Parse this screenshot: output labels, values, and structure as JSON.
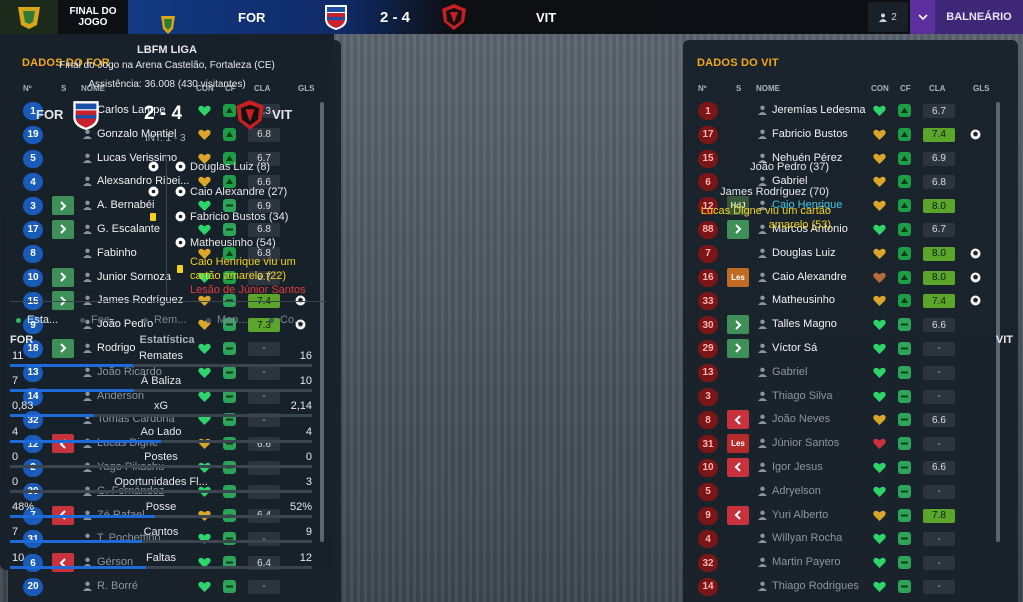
{
  "topbar": {
    "match_status": "FINAL DO JOGO",
    "home_abbr": "FOR",
    "score": "2 - 4",
    "away_abbr": "VIT",
    "viewers": "2",
    "dressing_room_label": "BALNEÁRIO"
  },
  "colors": {
    "home_blue": "#1a5ab8",
    "away_red": "#7a1616",
    "accent_orange": "#f4a81d",
    "rating_green": "#5aa52a",
    "bar_blue": "#1d6ad8",
    "card_yellow": "#f2d21f"
  },
  "home": {
    "title": "DADOS DO FOR",
    "columns": {
      "num": "Nº",
      "s": "S",
      "name": "NOME",
      "con": "CON",
      "cf": "CF",
      "cla": "CLA",
      "gls": "GLS"
    },
    "players": [
      {
        "num": "1",
        "sub": "",
        "name": "Carlos Lampe",
        "heart": "green",
        "cf": "up",
        "rating": "6.3",
        "good": false,
        "goal": false,
        "bench": false
      },
      {
        "num": "19",
        "sub": "",
        "name": "Gonzalo Montiel",
        "heart": "gold",
        "cf": "up",
        "rating": "6.8",
        "good": false,
        "goal": false,
        "bench": false
      },
      {
        "num": "5",
        "sub": "",
        "name": "Lucas Verissimo",
        "heart": "gold",
        "cf": "up",
        "rating": "6.7",
        "good": false,
        "goal": false,
        "bench": false
      },
      {
        "num": "4",
        "sub": "",
        "name": "Alexsandro Ribei...",
        "heart": "gold",
        "cf": "up",
        "rating": "6.6",
        "good": false,
        "goal": false,
        "bench": false
      },
      {
        "num": "3",
        "sub": "in",
        "name": "A. Bernabéi",
        "heart": "green",
        "cf": "flat",
        "rating": "6.9",
        "good": false,
        "goal": false,
        "bench": false
      },
      {
        "num": "17",
        "sub": "in",
        "name": "G. Escalante",
        "heart": "green",
        "cf": "flat",
        "rating": "6.8",
        "good": false,
        "goal": false,
        "bench": false
      },
      {
        "num": "8",
        "sub": "",
        "name": "Fabinho",
        "heart": "gold",
        "cf": "up",
        "rating": "6.8",
        "good": false,
        "goal": false,
        "bench": false
      },
      {
        "num": "10",
        "sub": "in",
        "name": "Junior Sornoza",
        "heart": "green",
        "cf": "up",
        "rating": "6.7",
        "good": false,
        "goal": false,
        "bench": false
      },
      {
        "num": "15",
        "sub": "in",
        "name": "James Rodríguez",
        "heart": "gold",
        "cf": "flat",
        "rating": "7.4",
        "good": true,
        "goal": true,
        "bench": false
      },
      {
        "num": "9",
        "sub": "",
        "name": "João Pedro",
        "heart": "gold",
        "cf": "flat",
        "rating": "7.3",
        "good": true,
        "goal": true,
        "bench": false
      },
      {
        "num": "18",
        "sub": "in",
        "name": "Rodrigo",
        "heart": "green",
        "cf": "flat",
        "rating": "-",
        "good": false,
        "goal": false,
        "bench": false
      },
      {
        "num": "13",
        "sub": "",
        "name": "João Ricardo",
        "heart": "green",
        "cf": "flat",
        "rating": "-",
        "good": false,
        "goal": false,
        "bench": true
      },
      {
        "num": "14",
        "sub": "",
        "name": "Anderson",
        "heart": "green",
        "cf": "flat",
        "rating": "-",
        "good": false,
        "goal": false,
        "bench": true
      },
      {
        "num": "32",
        "sub": "",
        "name": "Tomás Cardona",
        "heart": "green",
        "cf": "flat",
        "rating": "-",
        "good": false,
        "goal": false,
        "bench": true
      },
      {
        "num": "12",
        "sub": "out",
        "name": "Lucas Digne",
        "heart": "gold",
        "cf": "flat",
        "rating": "6.6",
        "good": false,
        "goal": false,
        "bench": true
      },
      {
        "num": "2",
        "sub": "",
        "name": "Yago Pikachu",
        "heart": "green",
        "cf": "flat",
        "rating": "-",
        "good": false,
        "goal": false,
        "bench": true
      },
      {
        "num": "30",
        "sub": "",
        "name": "G. Fernández",
        "heart": "green",
        "cf": "flat",
        "rating": "-",
        "good": false,
        "goal": false,
        "bench": true,
        "underline": true
      },
      {
        "num": "7",
        "sub": "out",
        "name": "Zé Rafael",
        "heart": "gold",
        "cf": "flat",
        "rating": "6.4",
        "good": false,
        "goal": false,
        "bench": true
      },
      {
        "num": "31",
        "sub": "",
        "name": "T. Pochettino",
        "heart": "green",
        "cf": "flat",
        "rating": "-",
        "good": false,
        "goal": false,
        "bench": true
      },
      {
        "num": "6",
        "sub": "out",
        "name": "Gérson",
        "heart": "green",
        "cf": "flat",
        "rating": "6.4",
        "good": false,
        "goal": false,
        "bench": true
      },
      {
        "num": "20",
        "sub": "",
        "name": "R. Borré",
        "heart": "green",
        "cf": "flat",
        "rating": "-",
        "good": false,
        "goal": false,
        "bench": true
      }
    ]
  },
  "away": {
    "title": "DADOS DO VIT",
    "columns": {
      "num": "Nº",
      "s": "S",
      "name": "NOME",
      "con": "CON",
      "cf": "CF",
      "cla": "CLA",
      "gls": "GLS"
    },
    "players": [
      {
        "num": "1",
        "sub": "",
        "name": "Jeremías Ledesma",
        "heart": "green",
        "cf": "up",
        "rating": "6.7",
        "good": false,
        "goal": false,
        "bench": false
      },
      {
        "num": "17",
        "sub": "",
        "name": "Fabricio Bustos",
        "heart": "gold",
        "cf": "up",
        "rating": "7.4",
        "good": true,
        "goal": true,
        "bench": false
      },
      {
        "num": "15",
        "sub": "",
        "name": "Nehuén Pérez",
        "heart": "gold",
        "cf": "up",
        "rating": "6.9",
        "good": false,
        "goal": false,
        "bench": false
      },
      {
        "num": "6",
        "sub": "",
        "name": "Gabriel",
        "heart": "gold",
        "cf": "up",
        "rating": "6.8",
        "good": false,
        "goal": false,
        "bench": false
      },
      {
        "num": "12",
        "sub": "tag",
        "tag": "HdJ",
        "name": "Caio Henrique",
        "heart": "gold",
        "cf": "up",
        "rating": "8.0",
        "good": true,
        "goal": false,
        "bench": false,
        "link": true
      },
      {
        "num": "88",
        "sub": "in",
        "name": "Marcos Antonio",
        "heart": "green",
        "cf": "up",
        "rating": "6.7",
        "good": false,
        "goal": false,
        "bench": false
      },
      {
        "num": "7",
        "sub": "",
        "name": "Douglas Luiz",
        "heart": "gold",
        "cf": "up",
        "rating": "8.0",
        "good": true,
        "goal": true,
        "bench": false
      },
      {
        "num": "16",
        "sub": "tag",
        "tag": "Les",
        "name": "Caio Alexandre",
        "heart": "brown",
        "cf": "up",
        "rating": "8.0",
        "good": true,
        "goal": true,
        "bench": false
      },
      {
        "num": "33",
        "sub": "",
        "name": "Matheusinho",
        "heart": "gold",
        "cf": "up",
        "rating": "7.4",
        "good": true,
        "goal": true,
        "bench": false
      },
      {
        "num": "30",
        "sub": "in",
        "name": "Talles Magno",
        "heart": "green",
        "cf": "flat",
        "rating": "6.6",
        "good": false,
        "goal": false,
        "bench": false
      },
      {
        "num": "29",
        "sub": "in",
        "name": "Víctor Sá",
        "heart": "green",
        "cf": "flat",
        "rating": "-",
        "good": false,
        "goal": false,
        "bench": false
      },
      {
        "num": "13",
        "sub": "",
        "name": "Gabriel",
        "heart": "green",
        "cf": "flat",
        "rating": "-",
        "good": false,
        "goal": false,
        "bench": true
      },
      {
        "num": "3",
        "sub": "",
        "name": "Thiago Silva",
        "heart": "green",
        "cf": "flat",
        "rating": "-",
        "good": false,
        "goal": false,
        "bench": true
      },
      {
        "num": "8",
        "sub": "out",
        "name": "João Neves",
        "heart": "gold",
        "cf": "flat",
        "rating": "6.6",
        "good": false,
        "goal": false,
        "bench": true
      },
      {
        "num": "31",
        "sub": "tagred",
        "tag": "Les",
        "name": "Júnior Santos",
        "heart": "red",
        "cf": "flat",
        "rating": "-",
        "good": false,
        "goal": false,
        "bench": true
      },
      {
        "num": "10",
        "sub": "out",
        "name": "Igor Jesus",
        "heart": "green",
        "cf": "flat",
        "rating": "6.6",
        "good": false,
        "goal": false,
        "bench": true
      },
      {
        "num": "5",
        "sub": "",
        "name": "Adryelson",
        "heart": "green",
        "cf": "flat",
        "rating": "-",
        "good": false,
        "goal": false,
        "bench": true
      },
      {
        "num": "9",
        "sub": "out",
        "name": "Yuri Alberto",
        "heart": "gold",
        "cf": "flat",
        "rating": "7.8",
        "good": true,
        "goal": false,
        "bench": true
      },
      {
        "num": "4",
        "sub": "",
        "name": "Willyan Rocha",
        "heart": "green",
        "cf": "flat",
        "rating": "-",
        "good": false,
        "goal": false,
        "bench": true
      },
      {
        "num": "32",
        "sub": "",
        "name": "Martin Payero",
        "heart": "green",
        "cf": "flat",
        "rating": "-",
        "good": false,
        "goal": false,
        "bench": true
      },
      {
        "num": "14",
        "sub": "",
        "name": "Thiago Rodrigues",
        "heart": "green",
        "cf": "flat",
        "rating": "-",
        "good": false,
        "goal": false,
        "bench": true
      }
    ]
  },
  "center": {
    "league": "LBFM LIGA",
    "venue": "Final do Jogo na Arena Castelão, Fortaleza (CE)",
    "attendance": "Assistência: 36.008 (430 visitantes)",
    "home_abbr": "FOR",
    "score": "2 - 4",
    "away_abbr": "VIT",
    "halftime": "INT: 1 - 3",
    "home_events": [
      "João Pedro (37)",
      "James Rodríguez (70)",
      "Lucas Digne viu um cartão",
      "amarelo (53)"
    ],
    "away_events": [
      "Douglas Luiz (8)",
      "Caio Alexandre (27)",
      "Fabricio Bustos (34)",
      "Matheusinho (54)",
      "Caio Henrique viu um",
      "cartão amarelo (22)",
      "Lesão de Júnior Santos"
    ],
    "tabs": [
      "Esta...",
      "Fee...",
      "Rem...",
      "Map...",
      "Co..."
    ],
    "stats_header": {
      "home": "FOR",
      "title": "Estatística",
      "away": "VIT"
    },
    "stats": [
      {
        "label": "Remates",
        "home": "11",
        "away": "16",
        "home_share": 0.407
      },
      {
        "label": "À Baliza",
        "home": "7",
        "away": "10",
        "home_share": 0.412
      },
      {
        "label": "xG",
        "home": "0,83",
        "away": "2,14",
        "home_share": 0.279
      },
      {
        "label": "Ao Lado",
        "home": "4",
        "away": "4",
        "home_share": 0.5
      },
      {
        "label": "Postes",
        "home": "0",
        "away": "0",
        "home_share": 0.0
      },
      {
        "label": "Oportunidades Fl...",
        "home": "0",
        "away": "3",
        "home_share": 0.0
      },
      {
        "label": "Posse",
        "home": "48%",
        "away": "52%",
        "home_share": 0.48
      },
      {
        "label": "Cantos",
        "home": "7",
        "away": "9",
        "home_share": 0.4375
      },
      {
        "label": "Faltas",
        "home": "10",
        "away": "12",
        "home_share": 0.45
      }
    ]
  }
}
